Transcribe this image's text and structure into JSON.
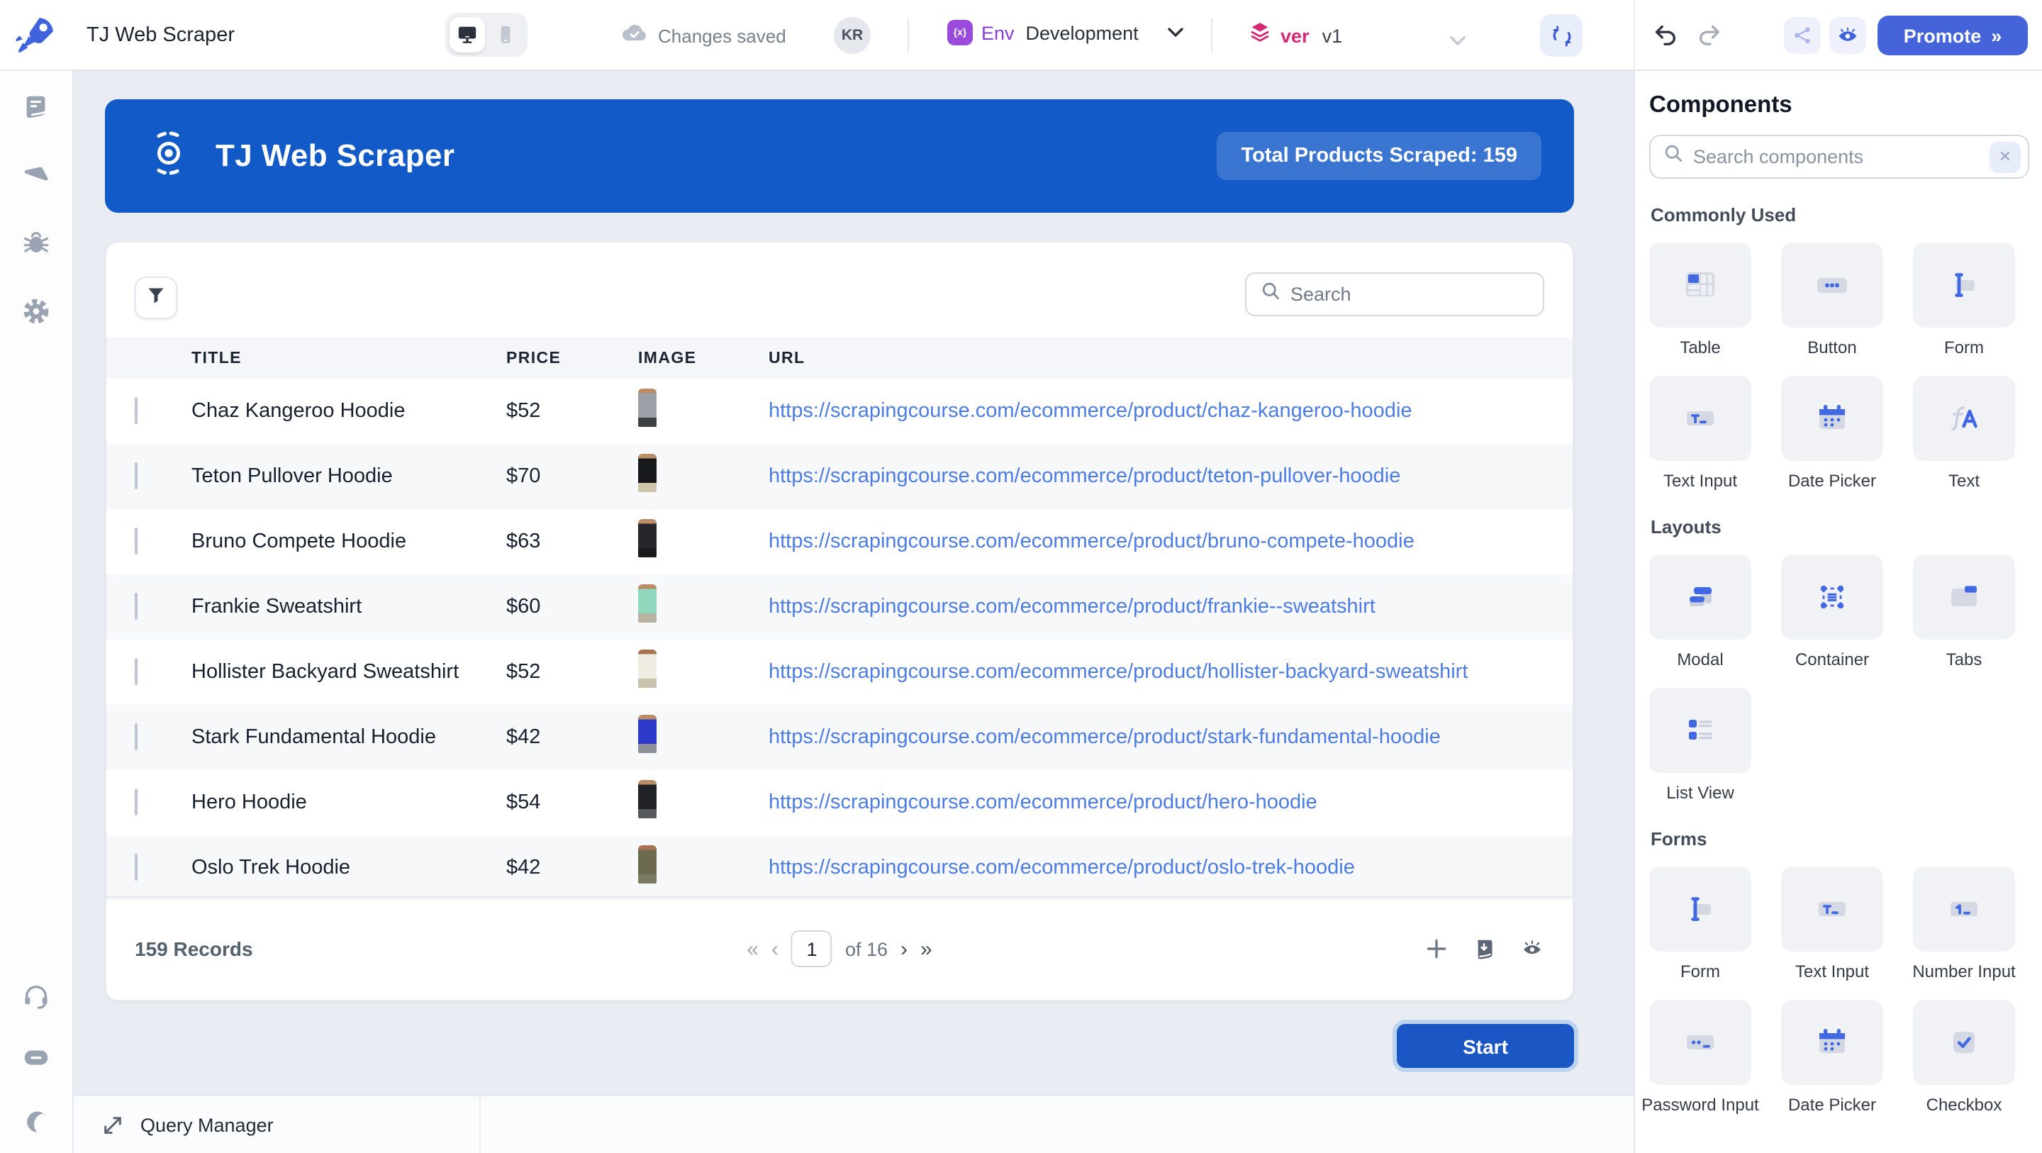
{
  "colors": {
    "accent_indigo": "#4368E3",
    "banner_blue": "#115ac8",
    "link_blue": "#4d7ce2",
    "env_purple": "#9a4bdc",
    "version_pink": "#d42a74",
    "canvas_bg": "#e9edf3"
  },
  "topbar": {
    "app_title": "TJ Web Scraper",
    "autosave_status": "Changes saved",
    "avatar_initials": "KR",
    "env_label": "Env",
    "env_value": "Development",
    "version_label": "ver",
    "version_value": "v1",
    "promote_label": "Promote",
    "promote_chevron": "»",
    "icons": [
      "logo-rocket-icon",
      "desktop-icon",
      "mobile-icon",
      "cloud-check-icon",
      "chevron-down-icon",
      "refresh-icon",
      "undo-icon",
      "redo-icon",
      "share-icon",
      "eye-icon"
    ]
  },
  "sidebar": {
    "icons_top": [
      "pages-icon",
      "inspector-icon",
      "debugger-icon",
      "settings-icon"
    ],
    "icons_bottom": [
      "support-icon",
      "chat-icon",
      "theme-moon-icon"
    ]
  },
  "canvas": {
    "banner": {
      "icon": "target-radar-icon",
      "title": "TJ Web Scraper",
      "badge": "Total Products Scraped: 159"
    },
    "table": {
      "filter_icon": "funnel-icon",
      "search_placeholder": "Search",
      "columns": [
        "TITLE",
        "PRICE",
        "IMAGE",
        "URL"
      ],
      "rows": [
        {
          "title": "Chaz Kangeroo Hoodie",
          "price": "$52",
          "url": "https://scrapingcourse.com/ecommerce/product/chaz-kangeroo-hoodie",
          "thumb": {
            "head": "#bb8d66",
            "body": "#9aa0a6",
            "legs": "#3c4043"
          }
        },
        {
          "title": "Teton Pullover Hoodie",
          "price": "$70",
          "url": "https://scrapingcourse.com/ecommerce/product/teton-pullover-hoodie",
          "thumb": {
            "head": "#bb8d66",
            "body": "#17181c",
            "legs": "#cfc5a8"
          }
        },
        {
          "title": "Bruno Compete Hoodie",
          "price": "$63",
          "url": "https://scrapingcourse.com/ecommerce/product/bruno-compete-hoodie",
          "thumb": {
            "head": "#bb8d66",
            "body": "#26262b",
            "legs": "#1b1b1f"
          }
        },
        {
          "title": "Frankie Sweatshirt",
          "price": "$60",
          "url": "https://scrapingcourse.com/ecommerce/product/frankie--sweatshirt",
          "thumb": {
            "head": "#bb8d66",
            "body": "#8fd8bd",
            "legs": "#b9b3a2"
          }
        },
        {
          "title": "Hollister Backyard Sweatshirt",
          "price": "$52",
          "url": "https://scrapingcourse.com/ecommerce/product/hollister-backyard-sweatshirt",
          "thumb": {
            "head": "#a97450",
            "body": "#efece2",
            "legs": "#c9c2ae"
          }
        },
        {
          "title": "Stark Fundamental Hoodie",
          "price": "$42",
          "url": "https://scrapingcourse.com/ecommerce/product/stark-fundamental-hoodie",
          "thumb": {
            "head": "#bb8d66",
            "body": "#2d39c8",
            "legs": "#8a8f98"
          }
        },
        {
          "title": "Hero Hoodie",
          "price": "$54",
          "url": "https://scrapingcourse.com/ecommerce/product/hero-hoodie",
          "thumb": {
            "head": "#bb8d66",
            "body": "#202127",
            "legs": "#55585f"
          }
        },
        {
          "title": "Oslo Trek Hoodie",
          "price": "$42",
          "url": "https://scrapingcourse.com/ecommerce/product/oslo-trek-hoodie",
          "thumb": {
            "head": "#a97450",
            "body": "#6e6a50",
            "legs": "#7d7a64"
          }
        }
      ],
      "footer": {
        "records": "159 Records",
        "first_glyph": "«",
        "prev_glyph": "‹",
        "page": "1",
        "of": "of 16",
        "next_glyph": "›",
        "last_glyph": "»",
        "icons": [
          "add-row-icon",
          "download-data-icon",
          "column-visibility-eye-icon"
        ]
      }
    },
    "start_button_label": "Start",
    "query_manager_label": "Query Manager"
  },
  "components_panel": {
    "title": "Components",
    "search_placeholder": "Search components",
    "clear_icon": "clear-x-icon",
    "sections": [
      {
        "label": "Commonly Used",
        "items": [
          {
            "label": "Table",
            "icon": "table-icon"
          },
          {
            "label": "Button",
            "icon": "button-icon"
          },
          {
            "label": "Form",
            "icon": "form-icon"
          },
          {
            "label": "Text Input",
            "icon": "text-input-icon"
          },
          {
            "label": "Date Picker",
            "icon": "date-picker-icon"
          },
          {
            "label": "Text",
            "icon": "text-icon"
          }
        ]
      },
      {
        "label": "Layouts",
        "items": [
          {
            "label": "Modal",
            "icon": "modal-icon"
          },
          {
            "label": "Container",
            "icon": "container-icon"
          },
          {
            "label": "Tabs",
            "icon": "tabs-icon"
          },
          {
            "label": "List View",
            "icon": "list-view-icon"
          }
        ]
      },
      {
        "label": "Forms",
        "items": [
          {
            "label": "Form",
            "icon": "form-icon"
          },
          {
            "label": "Text Input",
            "icon": "text-input-icon"
          },
          {
            "label": "Number Input",
            "icon": "number-input-icon"
          },
          {
            "label": "Password Input",
            "icon": "password-input-icon"
          },
          {
            "label": "Date Picker",
            "icon": "date-picker-icon"
          },
          {
            "label": "Checkbox",
            "icon": "checkbox-icon"
          }
        ]
      }
    ]
  }
}
